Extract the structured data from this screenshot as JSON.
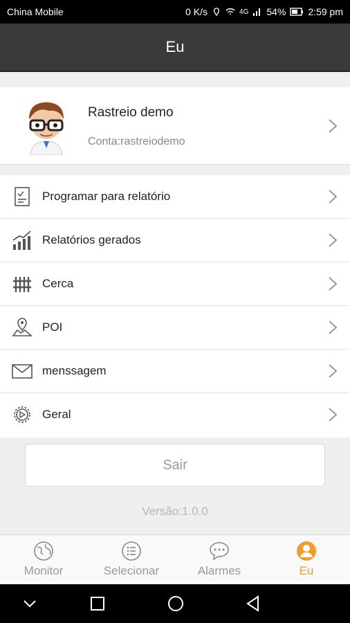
{
  "status_bar": {
    "carrier": "China Mobile",
    "speed": "0 K/s",
    "network": "4G",
    "battery": "54%",
    "time": "2:59 pm"
  },
  "header": {
    "title": "Eu"
  },
  "profile": {
    "name": "Rastreio demo",
    "account": "Conta:rastreiodemo"
  },
  "menu": [
    {
      "label": "Programar para relatório",
      "icon": "report-schedule-icon"
    },
    {
      "label": "Relatórios gerados",
      "icon": "chart-icon"
    },
    {
      "label": "Cerca",
      "icon": "fence-icon"
    },
    {
      "label": "POI",
      "icon": "poi-map-icon"
    },
    {
      "label": "menssagem",
      "icon": "mail-icon"
    },
    {
      "label": "Geral",
      "icon": "settings-gear-icon"
    }
  ],
  "logout_label": "Sair",
  "version": "Versão:1.0.0",
  "tabs": [
    {
      "label": "Monitor",
      "icon": "globe-icon"
    },
    {
      "label": "Selecionar",
      "icon": "list-icon"
    },
    {
      "label": "Alarmes",
      "icon": "chat-bubble-icon"
    },
    {
      "label": "Eu",
      "icon": "user-icon",
      "active": true
    }
  ],
  "colors": {
    "accent": "#f39c2a",
    "header_bg": "#3a3a3a"
  }
}
